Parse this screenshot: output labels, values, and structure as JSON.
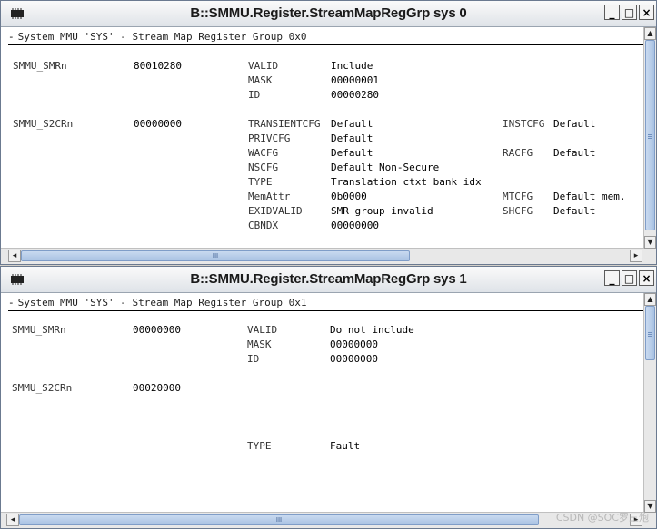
{
  "windows": [
    {
      "title": "B::SMMU.Register.StreamMapRegGrp sys 0",
      "header": "System MMU 'SYS' - Stream Map Register Group 0x0",
      "smr": {
        "name": "SMMU_SMRn",
        "value": "80010280",
        "fields": [
          {
            "label": "VALID",
            "value": "Include"
          },
          {
            "label": "MASK",
            "value": "00000001"
          },
          {
            "label": "ID",
            "value": "00000280"
          }
        ]
      },
      "s2cr": {
        "name": "SMMU_S2CRn",
        "value": "00000000",
        "fields": [
          {
            "label": "TRANSIENTCFG",
            "value": "Default"
          },
          {
            "label": "PRIVCFG",
            "value": "Default"
          },
          {
            "label": "WACFG",
            "value": "Default"
          },
          {
            "label": "NSCFG",
            "value": "Default Non-Secure"
          },
          {
            "label": "TYPE",
            "value": "Translation ctxt bank idx"
          },
          {
            "label": "MemAttr",
            "value": "0b0000"
          },
          {
            "label": "EXIDVALID",
            "value": "SMR group invalid"
          },
          {
            "label": "CBNDX",
            "value": "00000000"
          }
        ],
        "extra": [
          {
            "label": "INSTCFG",
            "value": "Default"
          },
          {
            "label": "RACFG",
            "value": "Default"
          },
          {
            "label": "MTCFG",
            "value": "Default mem."
          },
          {
            "label": "SHCFG",
            "value": "Default"
          }
        ]
      },
      "hscroll_grip": "III"
    },
    {
      "title": "B::SMMU.Register.StreamMapRegGrp sys 1",
      "header": "System MMU 'SYS' - Stream Map Register Group 0x1",
      "smr": {
        "name": "SMMU_SMRn",
        "value": "00000000",
        "fields": [
          {
            "label": "VALID",
            "value": "Do not include"
          },
          {
            "label": "MASK",
            "value": "00000000"
          },
          {
            "label": "ID",
            "value": "00000000"
          }
        ]
      },
      "s2cr": {
        "name": "SMMU_S2CRn",
        "value": "00020000",
        "fields": [
          {
            "label": "TYPE",
            "value": "Fault"
          }
        ]
      },
      "hscroll_grip": "III"
    }
  ],
  "window_buttons": {
    "minimize": "_",
    "maximize": "□",
    "close": "×"
  },
  "watermark": "CSDN @SOC罗三炮",
  "colors": {
    "title_bar": "#e6e9ed",
    "scroll_thumb": "#b7cce9",
    "background": "#ffffff"
  }
}
